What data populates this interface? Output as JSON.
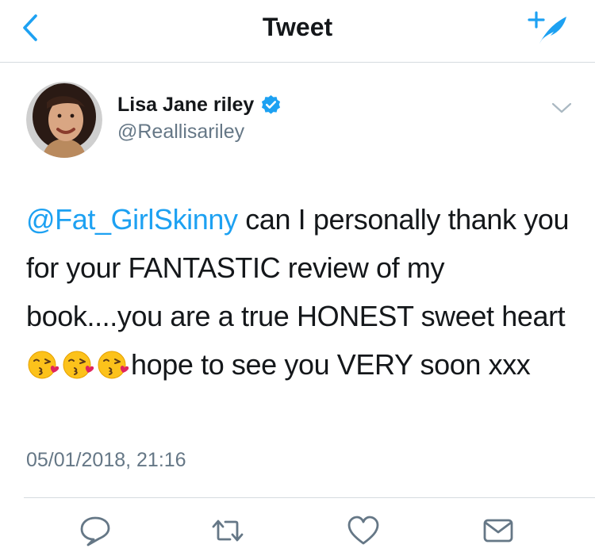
{
  "header": {
    "title": "Tweet",
    "back_icon": "chevron-left-icon",
    "compose_icon": "compose-tweet-icon"
  },
  "author": {
    "name": "Lisa Jane riley",
    "handle": "@Reallisariley",
    "verified": true,
    "avatar_icon": "profile-photo"
  },
  "tweet": {
    "mention": "@Fat_GirlSkinny",
    "text_part1": "can I personally thank you for your FANTASTIC review of my book....you are a true HONEST sweet heart",
    "emoji": "face-blowing-a-kiss",
    "emoji_count": 3,
    "text_part2": "hope to see you VERY soon xxx",
    "timestamp": "05/01/2018, 21:16"
  },
  "actions": [
    {
      "name": "reply-icon"
    },
    {
      "name": "retweet-icon"
    },
    {
      "name": "like-icon"
    },
    {
      "name": "direct-message-icon"
    }
  ],
  "colors": {
    "accent": "#1da1f2",
    "text": "#14171a",
    "secondary_text": "#657786",
    "divider": "#d6dbdf"
  }
}
